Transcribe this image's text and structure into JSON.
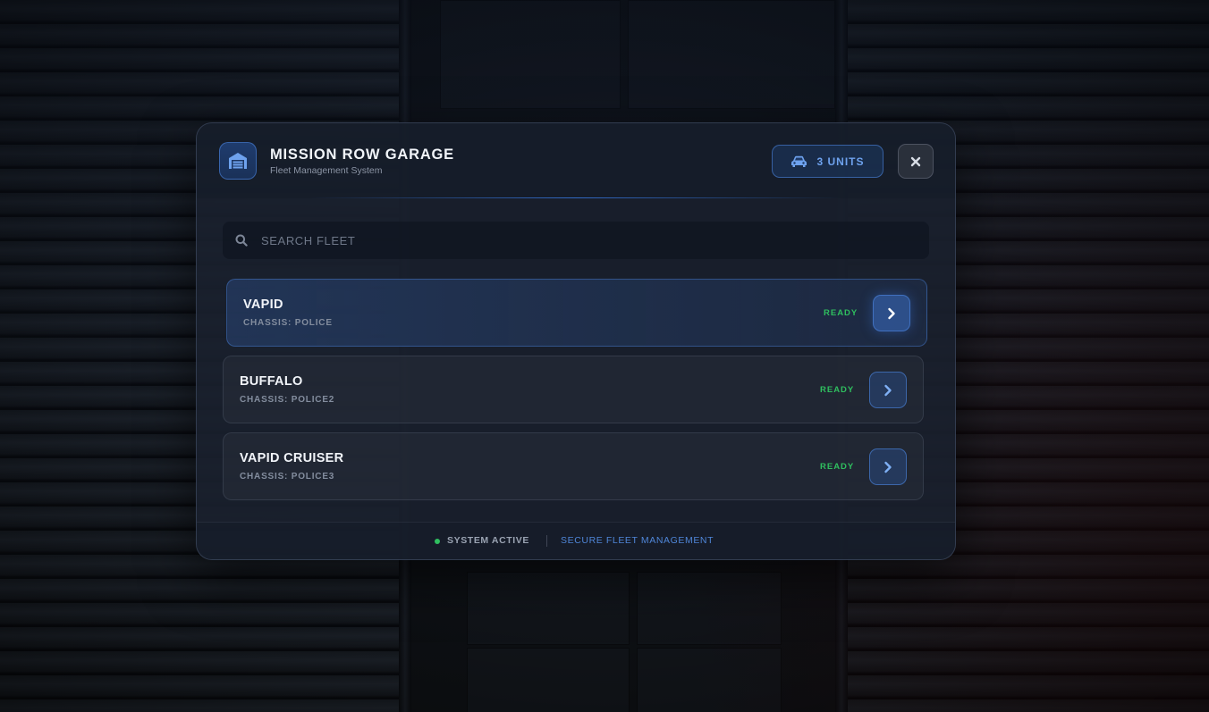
{
  "header": {
    "title": "MISSION ROW GARAGE",
    "subtitle": "Fleet Management System",
    "logo_icon": "garage-icon",
    "units_icon": "car-icon",
    "units_label": "3 UNITS",
    "close_icon": "close-icon"
  },
  "search": {
    "placeholder": "SEARCH FLEET",
    "value": "",
    "icon": "search-icon"
  },
  "vehicles": [
    {
      "name": "VAPID",
      "chassis": "CHASSIS: POLICE",
      "status": "READY",
      "selected": true
    },
    {
      "name": "BUFFALO",
      "chassis": "CHASSIS: POLICE2",
      "status": "READY",
      "selected": false
    },
    {
      "name": "VAPID CRUISER",
      "chassis": "CHASSIS: POLICE3",
      "status": "READY",
      "selected": false
    }
  ],
  "footer": {
    "status": "SYSTEM ACTIVE",
    "link": "SECURE FLEET MANAGEMENT"
  },
  "colors": {
    "accent": "#3b82f6",
    "ready": "#2fbf5f",
    "panel": "#19202d"
  }
}
